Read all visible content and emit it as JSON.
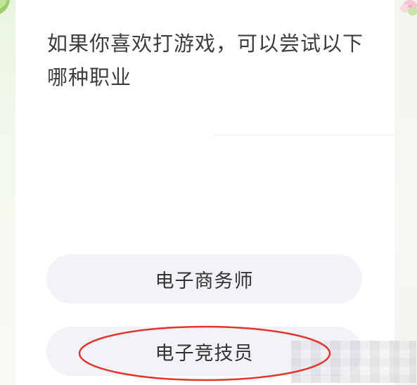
{
  "question": {
    "line1": "如果你喜欢打游戏，可以尝试以下",
    "line2": "哪种职业"
  },
  "options": [
    {
      "label": "电子商务师"
    },
    {
      "label": "电子竞技员"
    }
  ],
  "colors": {
    "option_bg": "#f1f3f6",
    "annotation": "#e3342f",
    "text": "#333333"
  },
  "icons": {
    "top_left": "leaf-icon",
    "top_right": "flower-icon"
  }
}
